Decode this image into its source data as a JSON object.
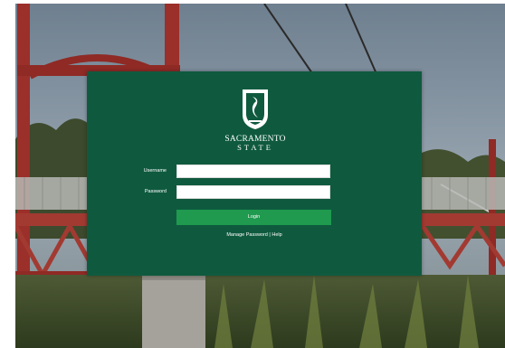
{
  "brand": {
    "line1": "SACRAMENTO",
    "line2": "STATE"
  },
  "form": {
    "username_label": "Username",
    "username_value": "",
    "password_label": "Password",
    "password_value": "",
    "login_label": "Login"
  },
  "links": {
    "manage_password": "Manage Password",
    "separator": "|",
    "help": "Help"
  },
  "colors": {
    "panel": "#0f5a3f",
    "button": "#1f9a4e"
  },
  "icons": {
    "logo": "sacramento-state-hornet-shield-icon"
  }
}
